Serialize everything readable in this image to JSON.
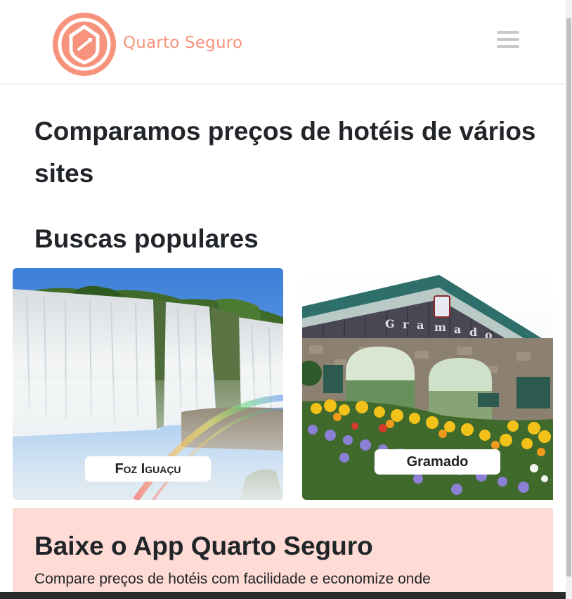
{
  "header": {
    "brand_name": "Quarto Seguro",
    "logo_icon": "shield-house-logo",
    "menu_icon": "hamburger-menu-icon",
    "brand_color": "#f7937d"
  },
  "hero": {
    "title": "Comparamos preços de hotéis de vários sites"
  },
  "popular": {
    "title": "Buscas populares",
    "cards": [
      {
        "label": "Foz Iguaçu",
        "image": "waterfall-with-rainbow"
      },
      {
        "label": "Gramado",
        "image": "gramado-stone-portal-with-flowers"
      }
    ]
  },
  "app_banner": {
    "title": "Baixe o App Quarto Seguro",
    "text": "Compare preços de hotéis com facilidade e economize onde",
    "background": "#fedcd5"
  }
}
